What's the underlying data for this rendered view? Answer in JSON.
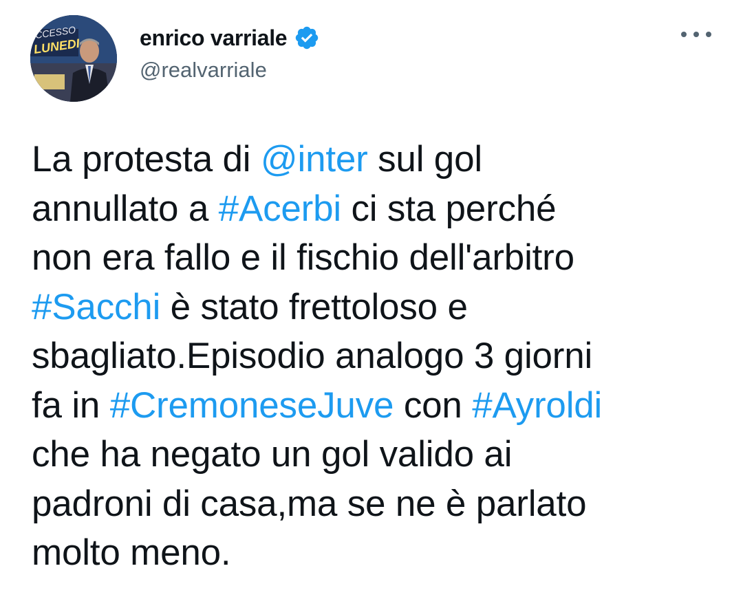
{
  "tweet": {
    "author": {
      "display_name": "enrico varriale",
      "handle": "@realvarriale",
      "verified": true,
      "avatar_text": [
        "CCESSO",
        "LUNEDI"
      ]
    },
    "body_lines": [
      [
        {
          "t": "La protesta di ",
          "link": false
        },
        {
          "t": "@inter",
          "link": true
        },
        {
          "t": " sul gol",
          "link": false
        }
      ],
      [
        {
          "t": "annullato a ",
          "link": false
        },
        {
          "t": "#Acerbi",
          "link": true
        },
        {
          "t": " ci sta perché",
          "link": false
        }
      ],
      [
        {
          "t": "non era fallo e il fischio dell'arbitro",
          "link": false
        }
      ],
      [
        {
          "t": "#Sacchi",
          "link": true
        },
        {
          "t": " è stato frettoloso e",
          "link": false
        }
      ],
      [
        {
          "t": "sbagliato.Episodio analogo 3 giorni",
          "link": false
        }
      ],
      [
        {
          "t": "fa in ",
          "link": false
        },
        {
          "t": "#CremoneseJuve",
          "link": true
        },
        {
          "t": " con ",
          "link": false
        },
        {
          "t": "#Ayroldi",
          "link": true
        }
      ],
      [
        {
          "t": "che ha negato un gol valido ai",
          "link": false
        }
      ],
      [
        {
          "t": "padroni di casa,ma se ne è parlato",
          "link": false
        }
      ],
      [
        {
          "t": "molto meno.",
          "link": false
        }
      ]
    ]
  },
  "colors": {
    "link": "#1d9bf0",
    "text": "#0f1419",
    "secondary": "#536471",
    "verified_badge": "#1d9bf0"
  },
  "icons": {
    "verified": "verified-badge-icon",
    "more": "more-options-icon"
  }
}
